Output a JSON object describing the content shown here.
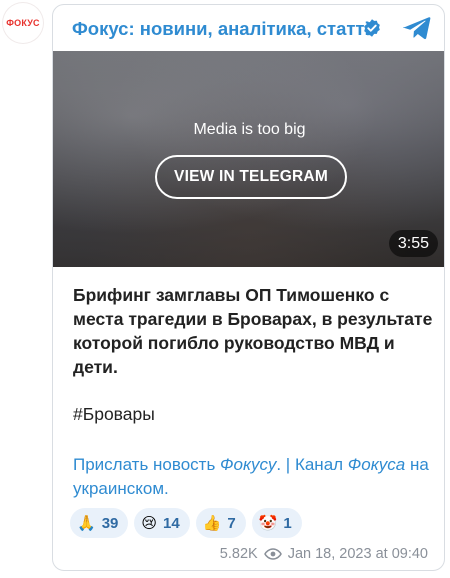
{
  "channel": {
    "avatar_label": "ФОКУС",
    "title": "Фокус: новини, аналітика, статті",
    "verified_icon": "verified-badge-icon",
    "share_icon": "telegram-icon",
    "accent_color": "#2f8bd1"
  },
  "media": {
    "note": "Media is too big",
    "button_label": "VIEW IN TELEGRAM",
    "duration": "3:55"
  },
  "post": {
    "text": "Брифинг замглавы ОП Тимошенко с места трагедии в Броварах, в результате которой погибло руководство МВД и дети.",
    "hashtag": "#Бровары",
    "links": {
      "part1": "Прислать новость ",
      "part2": "Фокусу",
      "part3": ". | Канал ",
      "part4": "Фокуса",
      "part5": " на украинском",
      "part6": "."
    }
  },
  "reactions": [
    {
      "emoji": "🙏",
      "icon": "praying-hands-icon",
      "count": "39"
    },
    {
      "emoji": "😢",
      "icon": "crying-face-icon",
      "count": "14"
    },
    {
      "emoji": "👍",
      "icon": "thumbs-up-icon",
      "count": "7"
    },
    {
      "emoji": "🤡",
      "icon": "clown-face-icon",
      "count": "1"
    }
  ],
  "meta": {
    "views": "5.82K",
    "views_icon": "eye-icon",
    "date": "Jan 18, 2023 at 09:40"
  }
}
